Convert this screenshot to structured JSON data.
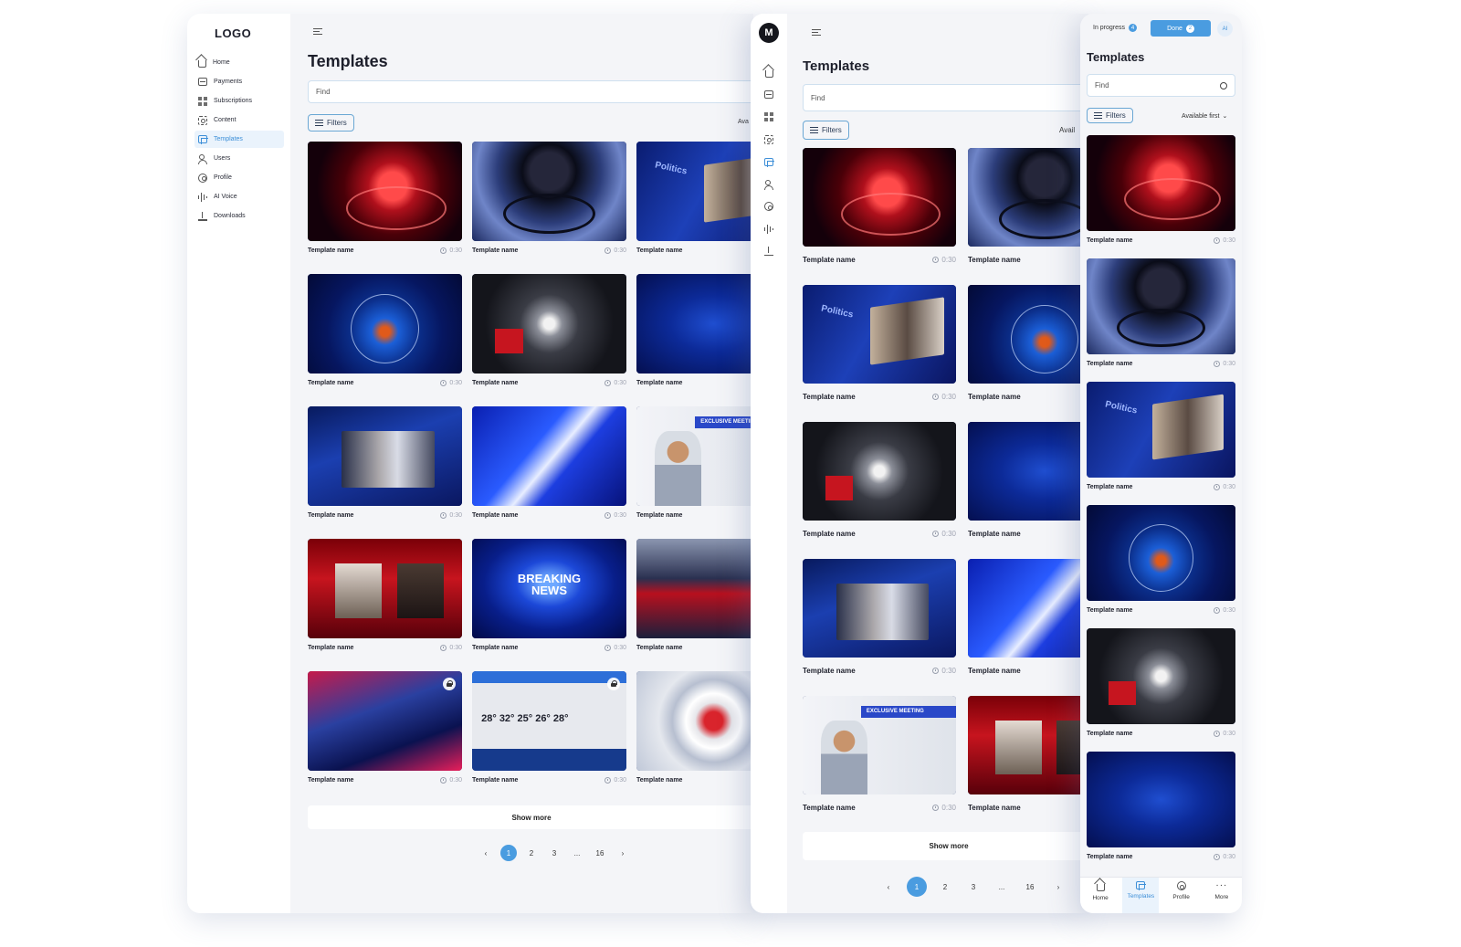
{
  "desktop": {
    "logo": "LOGO",
    "nav": [
      {
        "label": "Home",
        "icon": "home-icon"
      },
      {
        "label": "Payments",
        "icon": "payments-icon"
      },
      {
        "label": "Subscriptions",
        "icon": "subscriptions-icon"
      },
      {
        "label": "Content",
        "icon": "content-icon"
      },
      {
        "label": "Templates",
        "icon": "templates-icon",
        "active": true
      },
      {
        "label": "Users",
        "icon": "users-icon"
      },
      {
        "label": "Profile",
        "icon": "profile-icon"
      },
      {
        "label": "AI Voice",
        "icon": "ai-voice-icon"
      },
      {
        "label": "Downloads",
        "icon": "downloads-icon"
      }
    ],
    "title": "Templates",
    "search_placeholder": "Find",
    "filters_label": "Filters",
    "sort_label": "Ava",
    "cards": [
      {
        "name": "Template name",
        "duration": "0:30",
        "art": "red-globe"
      },
      {
        "name": "Template name",
        "duration": "0:30",
        "art": "dark-disc"
      },
      {
        "name": "Template name",
        "duration": "0:30",
        "art": "politics"
      },
      {
        "name": "Template name",
        "duration": "0:30",
        "art": "blue-globe"
      },
      {
        "name": "Template name",
        "duration": "0:30",
        "art": "tower"
      },
      {
        "name": "Template name",
        "duration": "0:30",
        "art": "blue-map"
      },
      {
        "name": "Template name",
        "duration": "0:30",
        "art": "news-desk"
      },
      {
        "name": "Template name",
        "duration": "0:30",
        "art": "blue-swirl"
      },
      {
        "name": "Template name",
        "duration": "0:30",
        "art": "exclusive"
      },
      {
        "name": "Template name",
        "duration": "0:30",
        "art": "phone-screen"
      },
      {
        "name": "Template name",
        "duration": "0:30",
        "art": "breaking-news"
      },
      {
        "name": "Template name",
        "duration": "0:30",
        "art": "studio"
      },
      {
        "name": "Template name",
        "duration": "0:30",
        "art": "red-room",
        "locked": true
      },
      {
        "name": "Template name",
        "duration": "0:30",
        "art": "weather",
        "locked": true
      },
      {
        "name": "Template name",
        "duration": "0:30",
        "art": "white-ball"
      }
    ],
    "show_more": "Show more",
    "pagination": {
      "prev": "‹",
      "pages": [
        "1",
        "2",
        "3",
        "...",
        "16"
      ],
      "current": "1",
      "next": "›"
    }
  },
  "tablet": {
    "avatar": "M",
    "title": "Templates",
    "search_placeholder": "Find",
    "filters_label": "Filters",
    "sort_label": "Avail",
    "cards": [
      {
        "name": "Template name",
        "duration": "0:30",
        "art": "red-globe"
      },
      {
        "name": "Template name",
        "duration": "",
        "art": "dark-disc"
      },
      {
        "name": "Template name",
        "duration": "0:30",
        "art": "politics"
      },
      {
        "name": "Template name",
        "duration": "",
        "art": "blue-globe"
      },
      {
        "name": "Template name",
        "duration": "0:30",
        "art": "tower"
      },
      {
        "name": "Template name",
        "duration": "",
        "art": "blue-map"
      },
      {
        "name": "Template name",
        "duration": "0:30",
        "art": "news-desk"
      },
      {
        "name": "Template name",
        "duration": "",
        "art": "blue-swirl"
      },
      {
        "name": "Template name",
        "duration": "0:30",
        "art": "exclusive"
      },
      {
        "name": "Template name",
        "duration": "",
        "art": "phone-screen"
      }
    ],
    "show_more": "Show more",
    "pagination": {
      "prev": "‹",
      "pages": [
        "1",
        "2",
        "3",
        "...",
        "16"
      ],
      "current": "1",
      "next": "›"
    }
  },
  "mobile": {
    "in_progress": {
      "label": "In progress",
      "count": "4"
    },
    "done": {
      "label": "Done",
      "count": "2"
    },
    "ai_label": "AI",
    "title": "Templates",
    "search_placeholder": "Find",
    "filters_label": "Filters",
    "sort_label": "Available first",
    "cards": [
      {
        "name": "Template name",
        "duration": "0:30",
        "art": "red-globe"
      },
      {
        "name": "Template name",
        "duration": "0:30",
        "art": "dark-disc"
      },
      {
        "name": "Template name",
        "duration": "0:30",
        "art": "politics"
      },
      {
        "name": "Template name",
        "duration": "0:30",
        "art": "blue-globe"
      },
      {
        "name": "Template name",
        "duration": "0:30",
        "art": "tower"
      },
      {
        "name": "Template name",
        "duration": "0:30",
        "art": "blue-map"
      }
    ],
    "bottom_nav": [
      {
        "label": "Home",
        "icon": "home-icon"
      },
      {
        "label": "Templates",
        "icon": "templates-icon",
        "active": true
      },
      {
        "label": "Profile",
        "icon": "profile-icon"
      },
      {
        "label": "More",
        "icon": "more-icon"
      }
    ]
  },
  "colors": {
    "accent": "#4a9ce0",
    "background": "#f4f5f8",
    "sidebar": "#ffffff"
  }
}
